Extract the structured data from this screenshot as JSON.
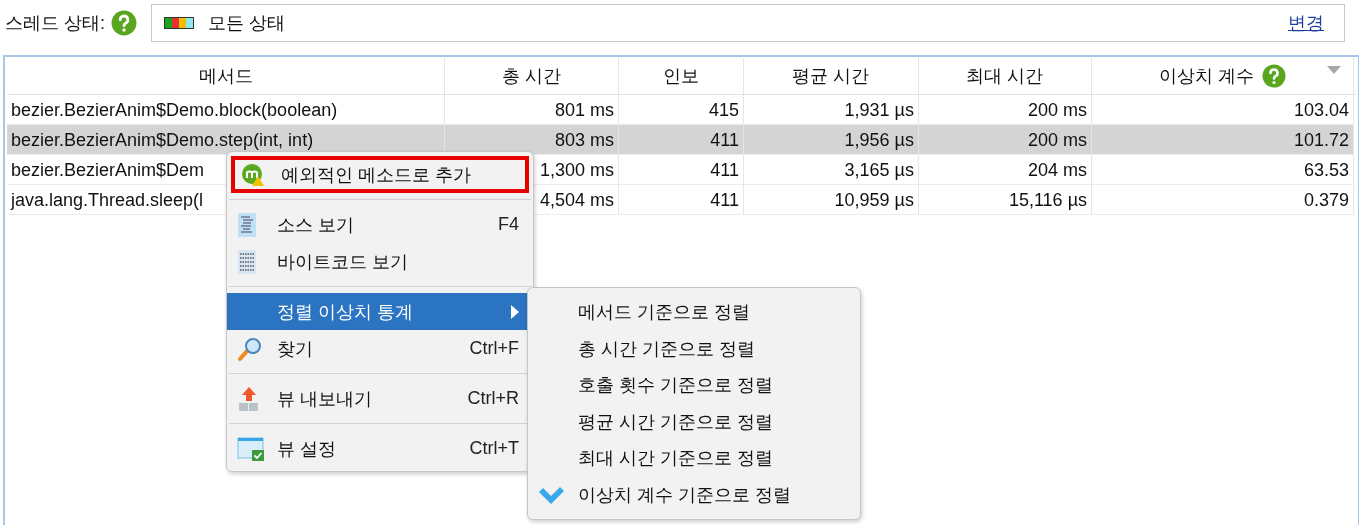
{
  "thread_state": {
    "label": "스레드 상태:",
    "value": "모든 상태",
    "link": "변경"
  },
  "table": {
    "columns": [
      {
        "title": "메서드",
        "help": false,
        "sorted": false
      },
      {
        "title": "총 시간",
        "help": false,
        "sorted": false
      },
      {
        "title": "인보",
        "help": false,
        "sorted": false
      },
      {
        "title": "평균 시간",
        "help": false,
        "sorted": false
      },
      {
        "title": "최대 시간",
        "help": false,
        "sorted": false
      },
      {
        "title": "이상치 계수",
        "help": true,
        "sorted": true
      }
    ],
    "rows": [
      {
        "selected": false,
        "cells": [
          "bezier.BezierAnim$Demo.block(boolean)",
          "801 ms",
          "415",
          "1,931 µs",
          "200 ms",
          "103.04"
        ]
      },
      {
        "selected": true,
        "cells": [
          "bezier.BezierAnim$Demo.step(int, int)",
          "803 ms",
          "411",
          "1,956 µs",
          "200 ms",
          "101.72"
        ]
      },
      {
        "selected": false,
        "cells": [
          "bezier.BezierAnim$Dem",
          "1,300 ms",
          "411",
          "3,165 µs",
          "204 ms",
          "63.53"
        ]
      },
      {
        "selected": false,
        "cells": [
          "java.lang.Thread.sleep(l",
          "4,504 ms",
          "411",
          "10,959 µs",
          "15,116 µs",
          "0.379"
        ]
      }
    ]
  },
  "context_menu": {
    "items": [
      {
        "kind": "item",
        "label": "예외적인 메소드로 추가",
        "selected": false,
        "outlined": true,
        "submenu": false
      },
      {
        "kind": "separator"
      },
      {
        "kind": "item",
        "label": "소스 보기",
        "shortcut": "F4",
        "selected": false,
        "outlined": false,
        "submenu": false
      },
      {
        "kind": "item",
        "label": "바이트코드 보기",
        "selected": false,
        "outlined": false,
        "submenu": false
      },
      {
        "kind": "separator"
      },
      {
        "kind": "item",
        "label": "정렬 이상치 통계",
        "selected": true,
        "outlined": false,
        "submenu": true
      },
      {
        "kind": "item",
        "label": "찾기",
        "shortcut": "Ctrl+F",
        "selected": false,
        "outlined": false,
        "submenu": false
      },
      {
        "kind": "separator"
      },
      {
        "kind": "item",
        "label": "뷰 내보내기",
        "shortcut": "Ctrl+R",
        "selected": false,
        "outlined": false,
        "submenu": false
      },
      {
        "kind": "separator"
      },
      {
        "kind": "item",
        "label": "뷰 설정",
        "shortcut": "Ctrl+T",
        "selected": false,
        "outlined": false,
        "submenu": false
      }
    ]
  },
  "submenu": {
    "items": [
      {
        "label": "메서드 기준으로 정렬",
        "checked": false
      },
      {
        "label": "총 시간 기준으로 정렬",
        "checked": false
      },
      {
        "label": "호출 횟수 기준으로 정렬",
        "checked": false
      },
      {
        "label": "평균 시간 기준으로 정렬",
        "checked": false
      },
      {
        "label": "최대 시간 기준으로 정렬",
        "checked": false
      },
      {
        "label": "이상치 계수 기준으로 정렬",
        "checked": true
      }
    ]
  }
}
